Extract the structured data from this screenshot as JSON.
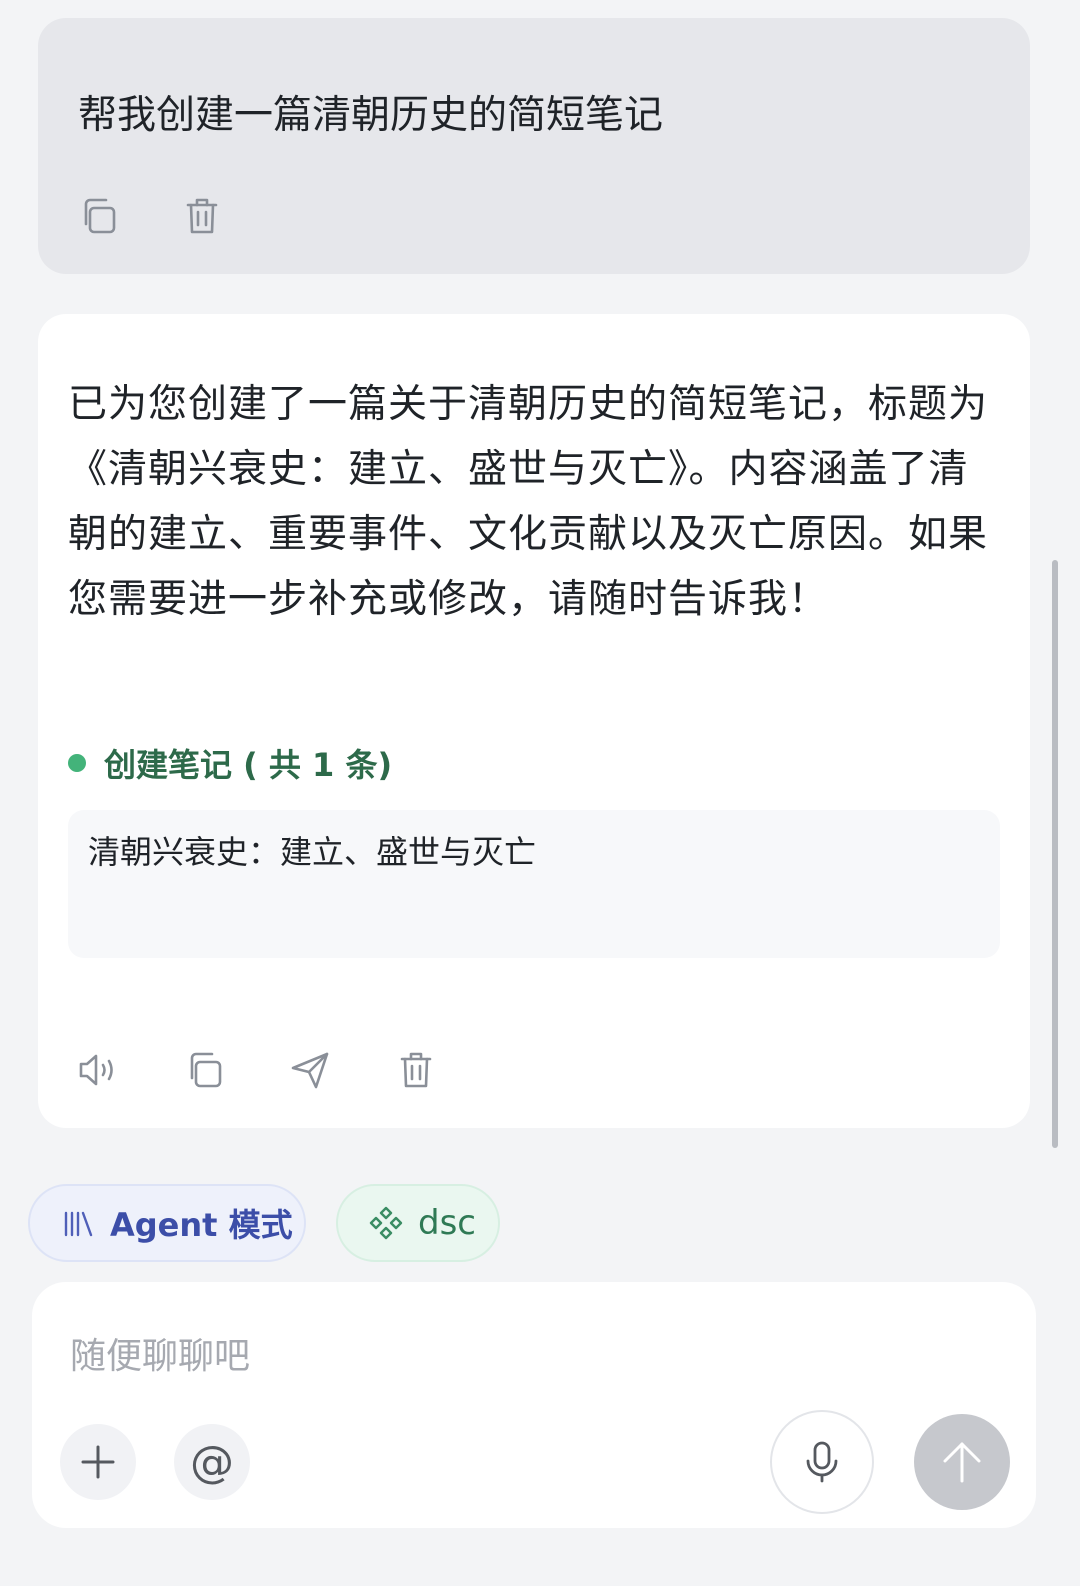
{
  "user_message": {
    "text": "帮我创建一篇清朝历史的简短笔记"
  },
  "assistant_message": {
    "text": "已为您创建了一篇关于清朝历史的简短笔记，标题为《清朝兴衰史：建立、盛世与灭亡》。内容涵盖了清朝的建立、重要事件、文化贡献以及灭亡原因。如果您需要进一步补充或修改，请随时告诉我！",
    "tool_label": "创建笔记 ( 共 1 条)",
    "note_title": "清朝兴衰史：建立、盛世与灭亡"
  },
  "chips": {
    "agent_label": "Agent 模式",
    "dsc_label": "dsc"
  },
  "composer": {
    "placeholder": "随便聊聊吧",
    "value": "",
    "at_symbol": "@"
  },
  "colors": {
    "accent_green": "#43b37a",
    "agent_blue": "#3c4ea8",
    "send_disabled": "#c6c8cd"
  },
  "icons": {
    "user_actions": [
      "copy-icon",
      "trash-icon"
    ],
    "assistant_actions": [
      "speaker-icon",
      "copy-icon",
      "share-icon",
      "trash-icon"
    ],
    "composer": [
      "plus-icon",
      "at-icon",
      "microphone-icon",
      "arrow-up-icon"
    ]
  }
}
